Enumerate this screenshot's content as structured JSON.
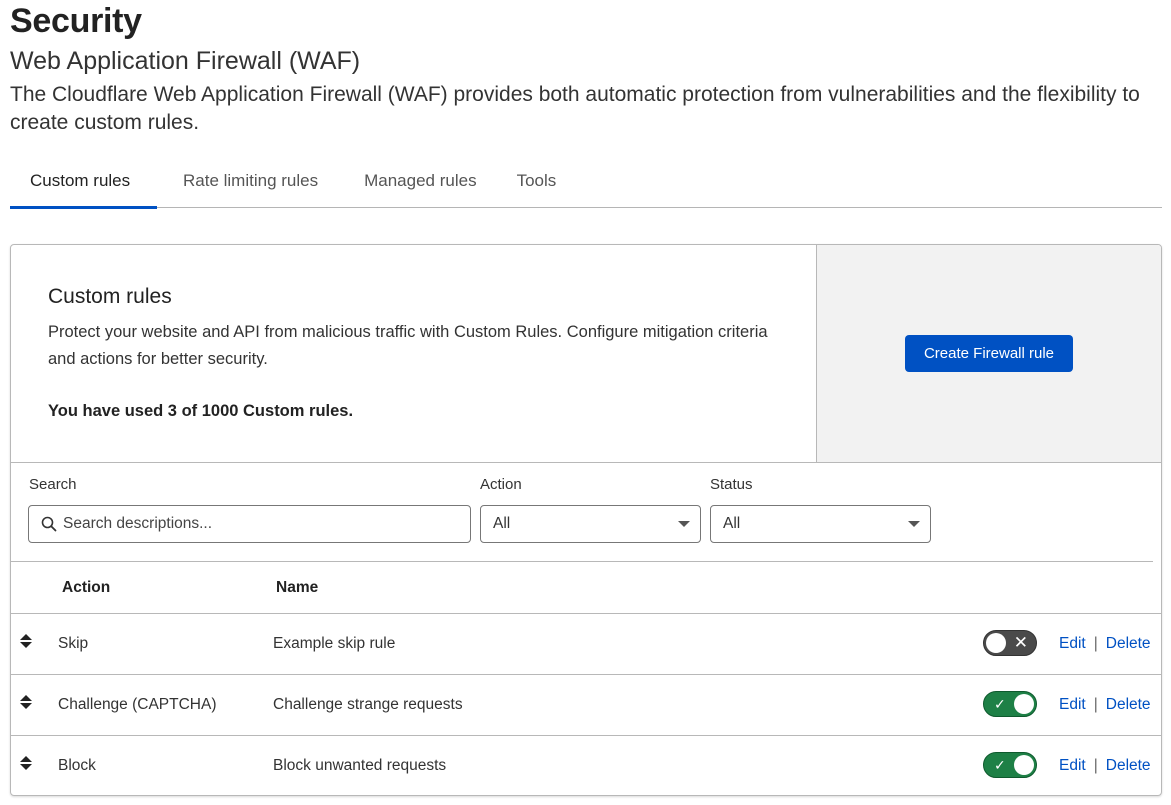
{
  "header": {
    "title": "Security",
    "subtitle": "Web Application Firewall (WAF)",
    "description": "The Cloudflare Web Application Firewall (WAF) provides both automatic protection from vulnerabilities and the flexibility to create custom rules."
  },
  "tabs": [
    {
      "label": "Custom rules",
      "active": true
    },
    {
      "label": "Rate limiting rules",
      "active": false
    },
    {
      "label": "Managed rules",
      "active": false
    },
    {
      "label": "Tools",
      "active": false
    }
  ],
  "intro": {
    "title": "Custom rules",
    "description": "Protect your website and API from malicious traffic with Custom Rules. Configure mitigation criteria and actions for better security.",
    "usage": "You have used 3 of 1000 Custom rules.",
    "create_button": "Create Firewall rule"
  },
  "filters": {
    "search_label": "Search",
    "search_placeholder": "Search descriptions...",
    "search_value": "",
    "action_label": "Action",
    "action_value": "All",
    "status_label": "Status",
    "status_value": "All"
  },
  "table": {
    "columns": [
      "Action",
      "Name"
    ],
    "rows": [
      {
        "action": "Skip",
        "name": "Example skip rule",
        "enabled": false,
        "edit": "Edit",
        "sep": "|",
        "delete": "Delete"
      },
      {
        "action": "Challenge (CAPTCHA)",
        "name": "Challenge strange requests",
        "enabled": true,
        "edit": "Edit",
        "sep": "|",
        "delete": "Delete"
      },
      {
        "action": "Block",
        "name": "Block unwanted requests",
        "enabled": true,
        "edit": "Edit",
        "sep": "|",
        "delete": "Delete"
      }
    ]
  },
  "icons": {
    "search": "search-icon",
    "drag": "drag-handle-icon",
    "caret": "caret-down-icon",
    "check": "✓",
    "cross": "✕"
  },
  "colors": {
    "accent": "#0051c3",
    "toggle_on": "#1e8046",
    "toggle_off": "#4a4a4a",
    "panel_bg": "#f2f2f2"
  }
}
